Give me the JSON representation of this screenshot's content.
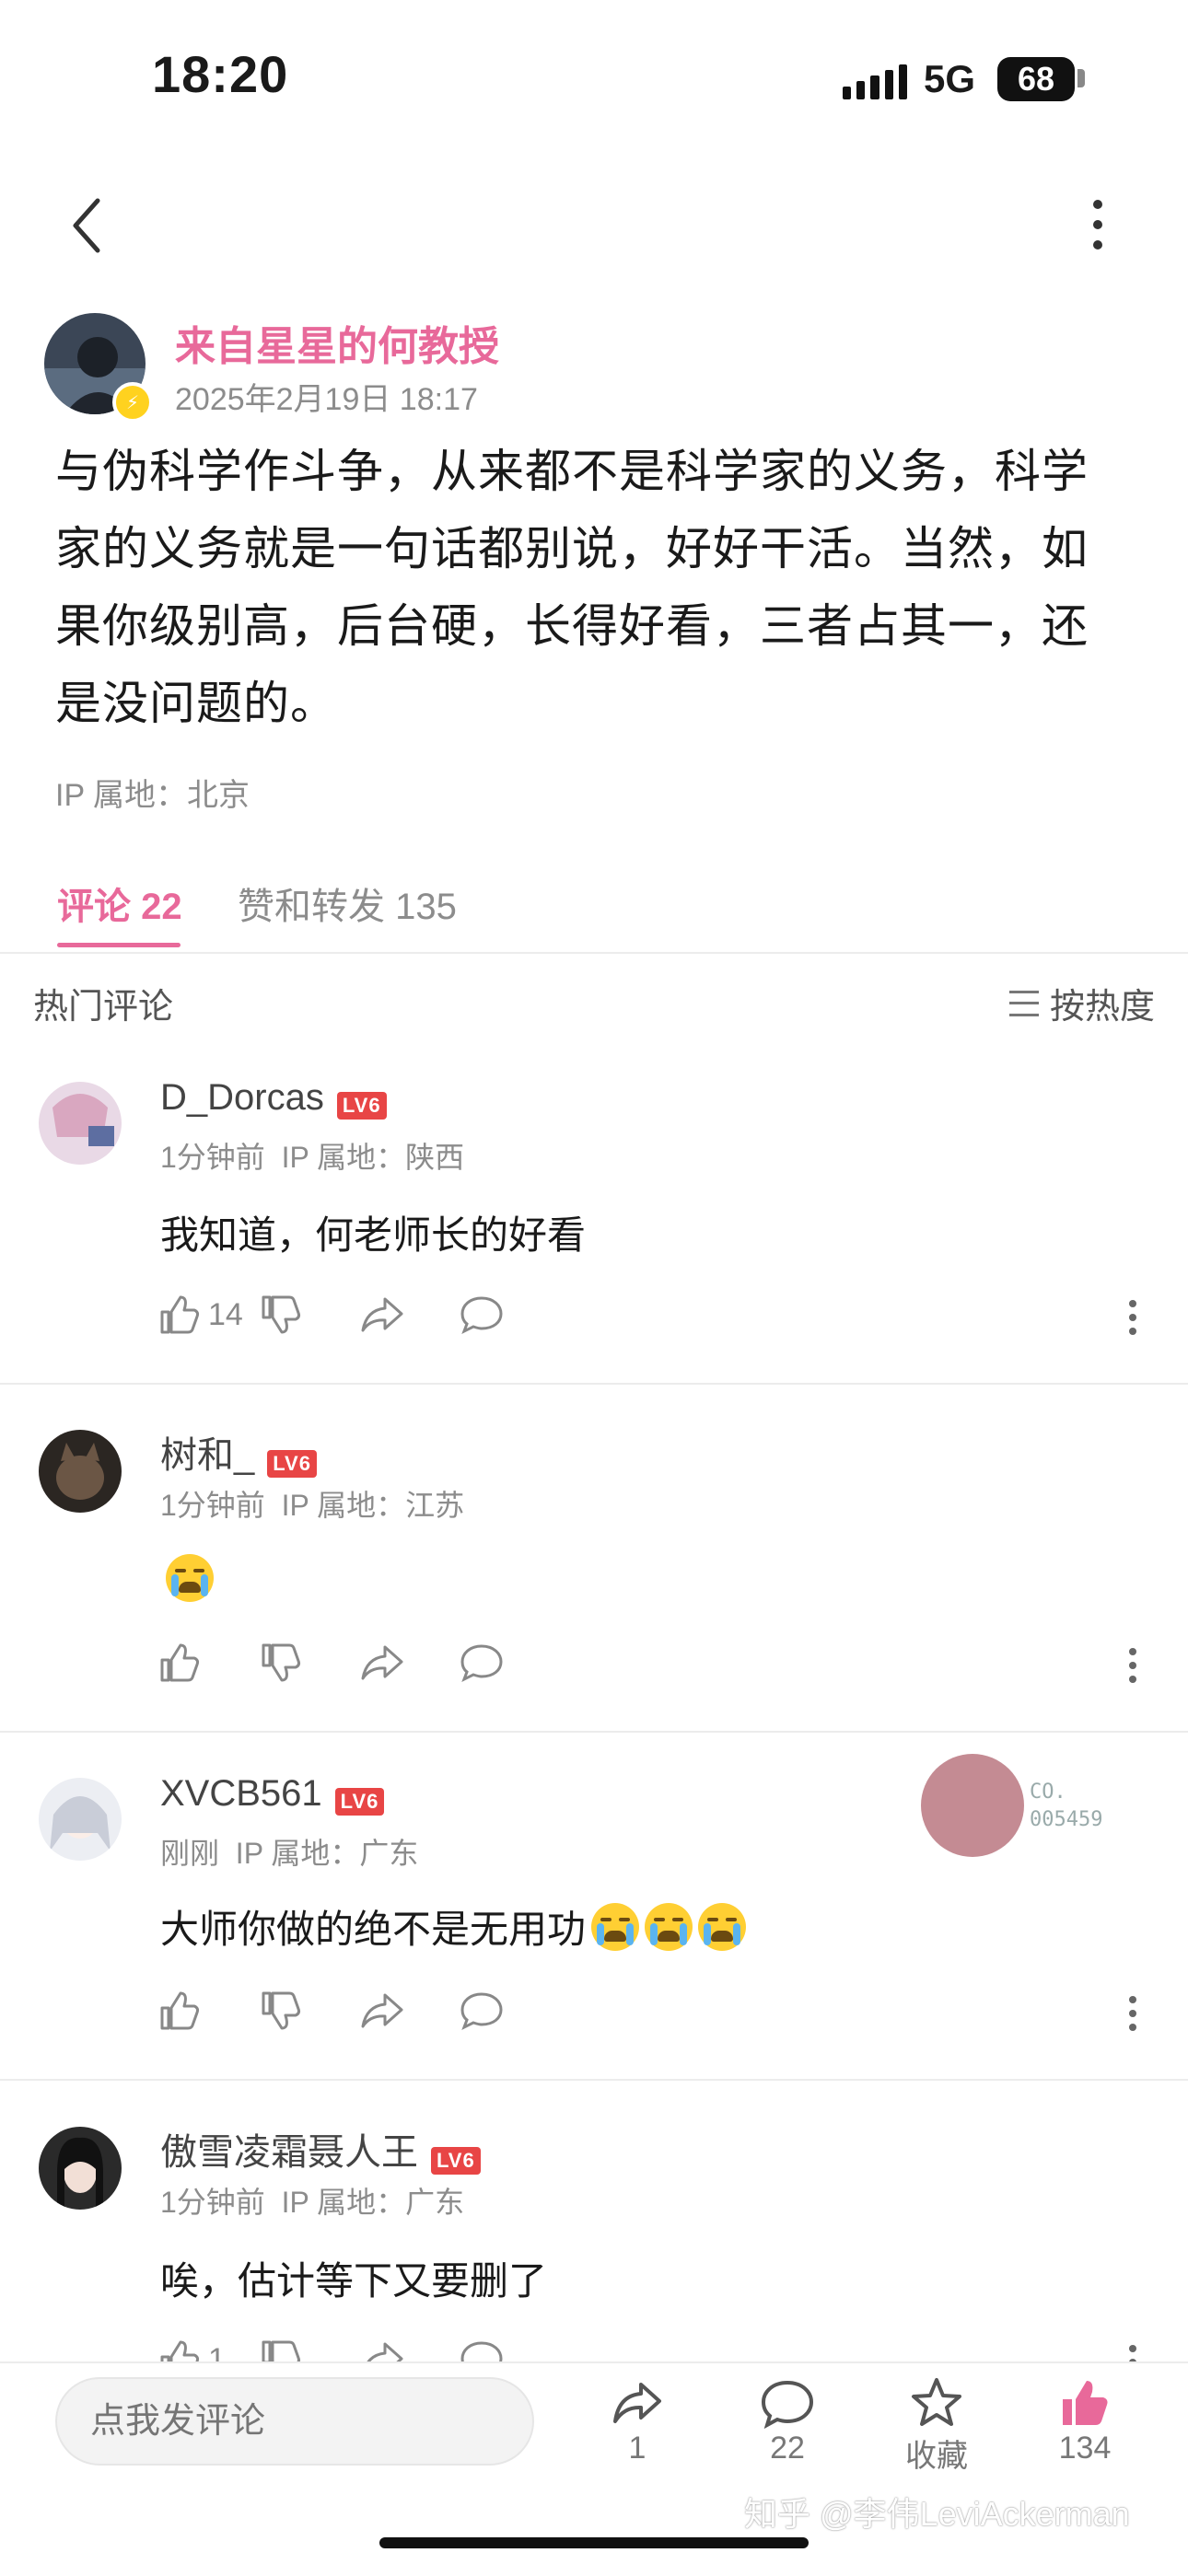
{
  "status_bar": {
    "time": "18:20",
    "network": "5G",
    "battery": "68"
  },
  "post": {
    "author": "来自星星的何教授",
    "time": "2025年2月19日 18:17",
    "content": "与伪科学作斗争，从来都不是科学家的义务，科学家的义务就是一句话都别说，好好干活。当然，如果你级别高，后台硬，长得好看，三者占其一，还是没问题的。",
    "ip": "IP 属地：北京"
  },
  "tabs": [
    {
      "label": "评论 22",
      "active": true
    },
    {
      "label": "赞和转发 135",
      "active": false
    }
  ],
  "comments_header": {
    "title": "热门评论",
    "sort": "按热度"
  },
  "comments": [
    {
      "name": "D_Dorcas",
      "level": "LV6",
      "time": "1分钟前",
      "ip": "IP 属地：陕西",
      "text": "我知道，何老师长的好看",
      "likes": "14",
      "emoji_count": 0
    },
    {
      "name": "树和_",
      "level": "LV6",
      "time": "1分钟前",
      "ip": "IP 属地：江苏",
      "text": "",
      "likes": "",
      "emoji_count": 1
    },
    {
      "name": "XVCB561",
      "level": "LV6",
      "time": "刚刚",
      "ip": "IP 属地：广东",
      "text": "大师你做的绝不是无用功",
      "likes": "",
      "emoji_count": 3
    },
    {
      "name": "傲雪凌霜聂人王",
      "level": "LV6",
      "time": "1分钟前",
      "ip": "IP 属地：广东",
      "text": "唉，估计等下又要删了",
      "likes": "1",
      "emoji_count": 0
    }
  ],
  "sticker": {
    "line1": "CO.",
    "line2": "005459"
  },
  "bottom_bar": {
    "input_placeholder": "点我发评论",
    "share_count": "1",
    "comment_count": "22",
    "favorite_label": "收藏",
    "like_count": "134"
  },
  "watermark": "知乎 @李伟LeviAckerman",
  "colors": {
    "accent": "#e8699a",
    "level_badge": "#e84545",
    "verify": "#ffd21f"
  }
}
